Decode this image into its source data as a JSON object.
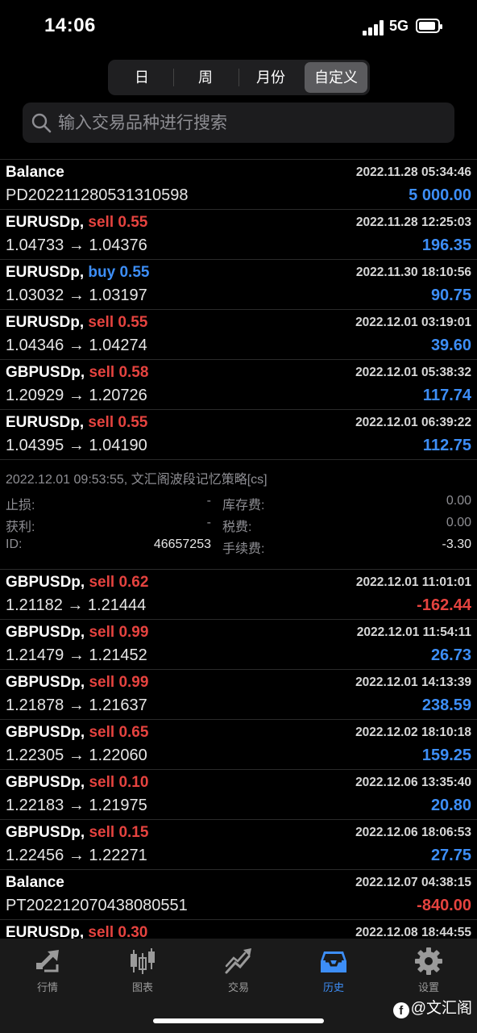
{
  "status": {
    "time": "14:06",
    "network": "5G"
  },
  "periods": [
    "日",
    "周",
    "月份",
    "自定义"
  ],
  "active_period": 3,
  "search": {
    "placeholder": "输入交易品种进行搜索"
  },
  "rows_top": [
    {
      "symbol": "Balance",
      "direction": "",
      "dir_type": "",
      "volume": "",
      "time": "2022.11.28 05:34:46",
      "prices": "PD202211280531310598",
      "profit": "5 000.00",
      "profit_sign": "pos"
    },
    {
      "symbol": "EURUSDp,",
      "direction": "sell",
      "dir_type": "sell",
      "volume": "0.55",
      "time": "2022.11.28 12:25:03",
      "prices": "1.04733 → 1.04376",
      "profit": "196.35",
      "profit_sign": "pos"
    },
    {
      "symbol": "EURUSDp,",
      "direction": "buy",
      "dir_type": "buy",
      "volume": "0.55",
      "time": "2022.11.30 18:10:56",
      "prices": "1.03032 → 1.03197",
      "profit": "90.75",
      "profit_sign": "pos"
    },
    {
      "symbol": "EURUSDp,",
      "direction": "sell",
      "dir_type": "sell",
      "volume": "0.55",
      "time": "2022.12.01 03:19:01",
      "prices": "1.04346 → 1.04274",
      "profit": "39.60",
      "profit_sign": "pos"
    },
    {
      "symbol": "GBPUSDp,",
      "direction": "sell",
      "dir_type": "sell",
      "volume": "0.58",
      "time": "2022.12.01 05:38:32",
      "prices": "1.20929 → 1.20726",
      "profit": "117.74",
      "profit_sign": "pos"
    },
    {
      "symbol": "EURUSDp,",
      "direction": "sell",
      "dir_type": "sell",
      "volume": "0.55",
      "time": "2022.12.01 06:39:22",
      "prices": "1.04395 → 1.04190",
      "profit": "112.75",
      "profit_sign": "pos"
    }
  ],
  "detail": {
    "title": "2022.12.01 09:53:55, 文汇阁波段记忆策略[cs]",
    "stop_loss_label": "止损:",
    "stop_loss_value": "-",
    "take_profit_label": "获利:",
    "take_profit_value": "-",
    "id_label": "ID:",
    "id_value": "46657253",
    "swap_label": "库存费:",
    "swap_value": "0.00",
    "tax_label": "税费:",
    "tax_value": "0.00",
    "commission_label": "手续费:",
    "commission_value": "-3.30"
  },
  "rows_bottom": [
    {
      "symbol": "GBPUSDp,",
      "direction": "sell",
      "dir_type": "sell",
      "volume": "0.62",
      "time": "2022.12.01 11:01:01",
      "prices": "1.21182 → 1.21444",
      "profit": "-162.44",
      "profit_sign": "neg"
    },
    {
      "symbol": "GBPUSDp,",
      "direction": "sell",
      "dir_type": "sell",
      "volume": "0.99",
      "time": "2022.12.01 11:54:11",
      "prices": "1.21479 → 1.21452",
      "profit": "26.73",
      "profit_sign": "pos"
    },
    {
      "symbol": "GBPUSDp,",
      "direction": "sell",
      "dir_type": "sell",
      "volume": "0.99",
      "time": "2022.12.01 14:13:39",
      "prices": "1.21878 → 1.21637",
      "profit": "238.59",
      "profit_sign": "pos"
    },
    {
      "symbol": "GBPUSDp,",
      "direction": "sell",
      "dir_type": "sell",
      "volume": "0.65",
      "time": "2022.12.02 18:10:18",
      "prices": "1.22305 → 1.22060",
      "profit": "159.25",
      "profit_sign": "pos"
    },
    {
      "symbol": "GBPUSDp,",
      "direction": "sell",
      "dir_type": "sell",
      "volume": "0.10",
      "time": "2022.12.06 13:35:40",
      "prices": "1.22183 → 1.21975",
      "profit": "20.80",
      "profit_sign": "pos"
    },
    {
      "symbol": "GBPUSDp,",
      "direction": "sell",
      "dir_type": "sell",
      "volume": "0.15",
      "time": "2022.12.06 18:06:53",
      "prices": "1.22456 → 1.22271",
      "profit": "27.75",
      "profit_sign": "pos"
    },
    {
      "symbol": "Balance",
      "direction": "",
      "dir_type": "",
      "volume": "",
      "time": "2022.12.07 04:38:15",
      "prices": "PT202212070438080551",
      "profit": "-840.00",
      "profit_sign": "neg"
    },
    {
      "symbol": "EURUSDp,",
      "direction": "sell",
      "dir_type": "sell",
      "volume": "0.30",
      "time": "2022.12.08 18:44:55",
      "prices": "",
      "profit": "",
      "profit_sign": "pos"
    }
  ],
  "tabs": [
    {
      "label": "行情",
      "icon": "quotes-icon"
    },
    {
      "label": "图表",
      "icon": "chart-candles-icon"
    },
    {
      "label": "交易",
      "icon": "trade-icon"
    },
    {
      "label": "历史",
      "icon": "history-inbox-icon"
    },
    {
      "label": "设置",
      "icon": "gear-icon"
    }
  ],
  "active_tab": 3,
  "colors": {
    "sell": "#e5433f",
    "buy": "#3d8ef7",
    "active_tab": "#3d8ef7"
  },
  "watermark": {
    "icon_text": "f",
    "text": "@文汇阁"
  }
}
